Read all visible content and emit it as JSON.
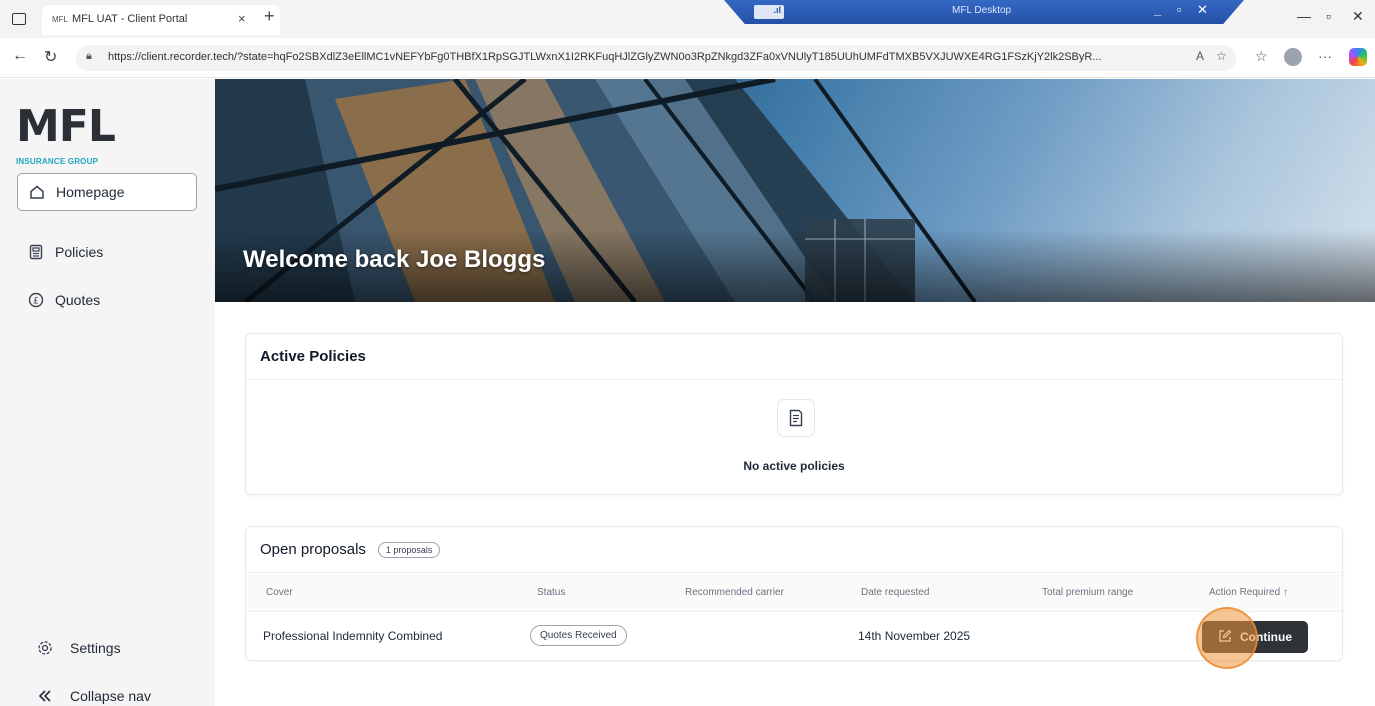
{
  "browser": {
    "tab_favicon": "MFL",
    "tab_title": "MFL UAT - Client Portal",
    "tab_close": "×",
    "new_tab": "+",
    "url": "https://client.recorder.tech/?state=hqFo2SBXdlZ3eEllMC1vNEFYbFg0THBfX1RpSGJTLWxnX1I2RKFuqHJlZGlyZWN0o3RpZNkgd3ZFa0xVNUlyT185UUhUMFdTMXB5VXJUWXE4RG1FSzKjY2lk2SByR...",
    "remote_title": "MFL Desktop",
    "remote_signal": ".ıl"
  },
  "sidebar": {
    "logo_text": "MFL",
    "logo_subtitle": "INSURANCE GROUP",
    "items": [
      {
        "label": "Homepage",
        "icon": "home-icon",
        "active": true
      },
      {
        "label": "Policies",
        "icon": "policies-icon",
        "active": false
      },
      {
        "label": "Quotes",
        "icon": "pound-icon",
        "active": false
      }
    ],
    "settings_label": "Settings",
    "collapse_label": "Collapse nav"
  },
  "hero": {
    "title": "Welcome back Joe Bloggs"
  },
  "active_policies": {
    "title": "Active Policies",
    "empty_text": "No active policies"
  },
  "open_proposals": {
    "title": "Open proposals",
    "count_badge": "1 proposals",
    "columns": [
      "Cover",
      "Status",
      "Recommended carrier",
      "Date requested",
      "Total premium range",
      "Action Required ↑"
    ],
    "rows": [
      {
        "cover": "Professional Indemnity Combined",
        "status": "Quotes Received",
        "carrier": "",
        "date_requested": "14th November 2025",
        "premium_range": "",
        "action_label": "Continue"
      }
    ]
  },
  "colors": {
    "brand_dark": "#2b2f36",
    "brand_accent": "#1fa5c0",
    "button_dark": "#2f3337",
    "click_highlight": "#f0963c"
  }
}
